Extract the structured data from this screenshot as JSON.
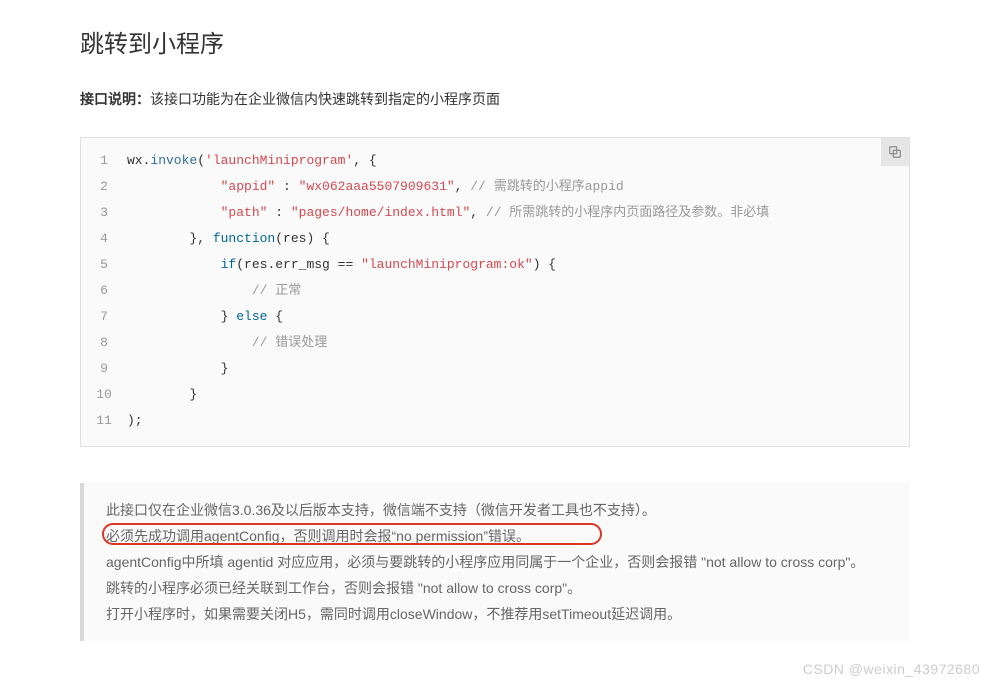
{
  "title": "跳转到小程序",
  "desc_label": "接口说明：",
  "desc_text": "该接口功能为在企业微信内快速跳转到指定的小程序页面",
  "code": {
    "lines": [
      {
        "n": "1",
        "pre": "wx.",
        "fn": "invoke",
        "after_fn": "(",
        "str": "'launchMiniprogram'",
        "tail": ", {"
      },
      {
        "n": "2",
        "indent": "            ",
        "str1": "\"appid\"",
        "mid": " : ",
        "str2": "\"wx062aaa5507909631\"",
        "comma": ",",
        "cmt": " // 需跳转的小程序appid"
      },
      {
        "n": "3",
        "indent": "            ",
        "str1": "\"path\"",
        "mid": " : ",
        "str2": "\"pages/home/index.html\"",
        "comma": ",",
        "cmt": " // 所需跳转的小程序内页面路径及参数。非必填"
      },
      {
        "n": "4",
        "indent": "        ",
        "plain1": "}, ",
        "kw": "function",
        "plain2": "(res) {"
      },
      {
        "n": "5",
        "indent": "            ",
        "kw": "if",
        "plain1": "(res.err_msg == ",
        "str": "\"launchMiniprogram:ok\"",
        "plain2": ") {"
      },
      {
        "n": "6",
        "indent": "                ",
        "cmt": "// 正常"
      },
      {
        "n": "7",
        "indent": "            ",
        "plain1": "} ",
        "kw": "else",
        "plain2": " {"
      },
      {
        "n": "8",
        "indent": "                ",
        "cmt": "// 错误处理"
      },
      {
        "n": "9",
        "indent": "            ",
        "plain1": "}"
      },
      {
        "n": "10",
        "indent": "        ",
        "plain1": "}"
      },
      {
        "n": "11",
        "plain1": ");"
      }
    ]
  },
  "notes": {
    "l1": "此接口仅在企业微信3.0.36及以后版本支持，微信端不支持（微信开发者工具也不支持）。",
    "l2": "必须先成功调用agentConfig，否则调用时会报“no permission”错误。",
    "l3": "agentConfig中所填 agentid 对应应用，必须与要跳转的小程序应用同属于一个企业，否则会报错 \"not allow to cross corp\"。",
    "l4": "跳转的小程序必须已经关联到工作台，否则会报错 \"not allow to cross corp\"。",
    "l5": "打开小程序时，如果需要关闭H5，需同时调用closeWindow，不推荐用setTimeout延迟调用。"
  },
  "watermark": "CSDN @weixin_43972680"
}
